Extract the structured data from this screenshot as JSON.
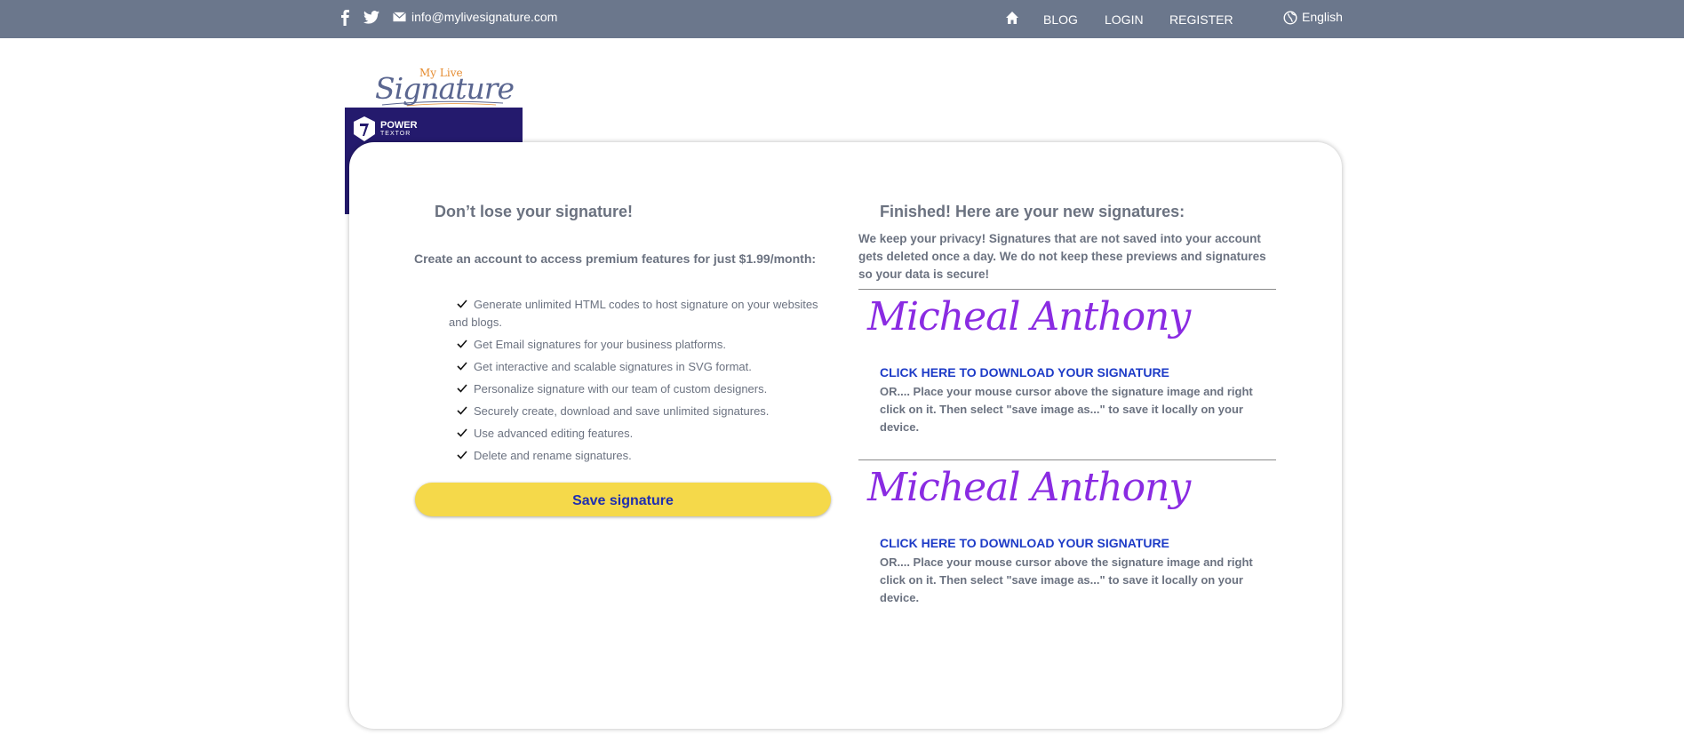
{
  "topbar": {
    "email": "info@mylivesignature.com",
    "nav": [
      "BLOG",
      "LOGIN",
      "REGISTER"
    ],
    "language": "English",
    "icons": [
      "facebook-icon",
      "twitter-icon",
      "mail-icon",
      "home-icon",
      "globe-icon"
    ]
  },
  "logo": {
    "top": "My Live",
    "main": "Signature"
  },
  "ad": {
    "line1": "POWER",
    "line2": "TEXTOR"
  },
  "left": {
    "title": "Don’t lose your signature!",
    "intro": "Create an account to access premium features for just $1.99/month:",
    "features": [
      "Generate unlimited HTML codes to host signature on your websites and blogs.",
      "Get Email signatures for your business platforms.",
      "Get interactive and scalable signatures in SVG format.",
      "Personalize signature with our team of custom designers.",
      "Securely create, download and save unlimited signatures.",
      "Use advanced editing features.",
      "Delete and rename signatures."
    ],
    "save_label": "Save signature"
  },
  "right": {
    "title": "Finished! Here are your new signatures:",
    "privacy": "We keep your privacy! Signatures that are not saved into your account gets deleted once a day. We do not keep these previews and signatures so your data is secure!",
    "signatures": [
      {
        "name": "Micheal Anthony",
        "download": "CLICK HERE TO DOWNLOAD YOUR SIGNATURE",
        "instructions": "OR.... Place your mouse cursor above the signature image and right click on it. Then select \"save image as...\" to save it locally on your device."
      },
      {
        "name": "Micheal Anthony",
        "download": "CLICK HERE TO DOWNLOAD YOUR SIGNATURE",
        "instructions": "OR.... Place your mouse cursor above the signature image and right click on it. Then select \"save image as...\" to save it locally on your device."
      }
    ]
  },
  "colors": {
    "topbar": "#6b778c",
    "accent_button": "#f5d94a",
    "link": "#1d3bc7",
    "signature": "#8a2be2",
    "ad_background": "#241a6d"
  }
}
